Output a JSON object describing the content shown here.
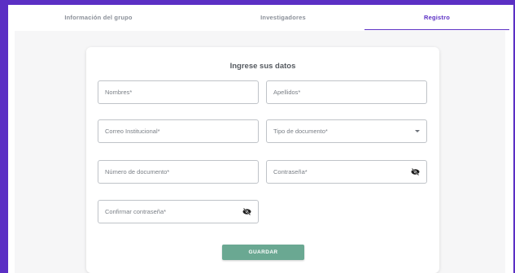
{
  "tabs": [
    {
      "label": "Información del grupo",
      "active": false
    },
    {
      "label": "Investigadores",
      "active": false
    },
    {
      "label": "Registro",
      "active": true
    }
  ],
  "form": {
    "title": "Ingrese sus datos",
    "fields": {
      "nombres": "Nombres*",
      "apellidos": "Apellidos*",
      "correo": "Correo Institucional*",
      "tipo_documento": "Tipo de documento*",
      "numero_documento": "Número de documento*",
      "contrasena": "Contraseña*",
      "confirmar_contrasena": "Confirmar contraseña*"
    },
    "save_label": "GUARDAR"
  },
  "icons": {
    "password_toggle": "eye-off-icon",
    "select_caret": "chevron-down-icon"
  },
  "colors": {
    "accent": "#5b2fc4",
    "button": "#6aa892"
  }
}
